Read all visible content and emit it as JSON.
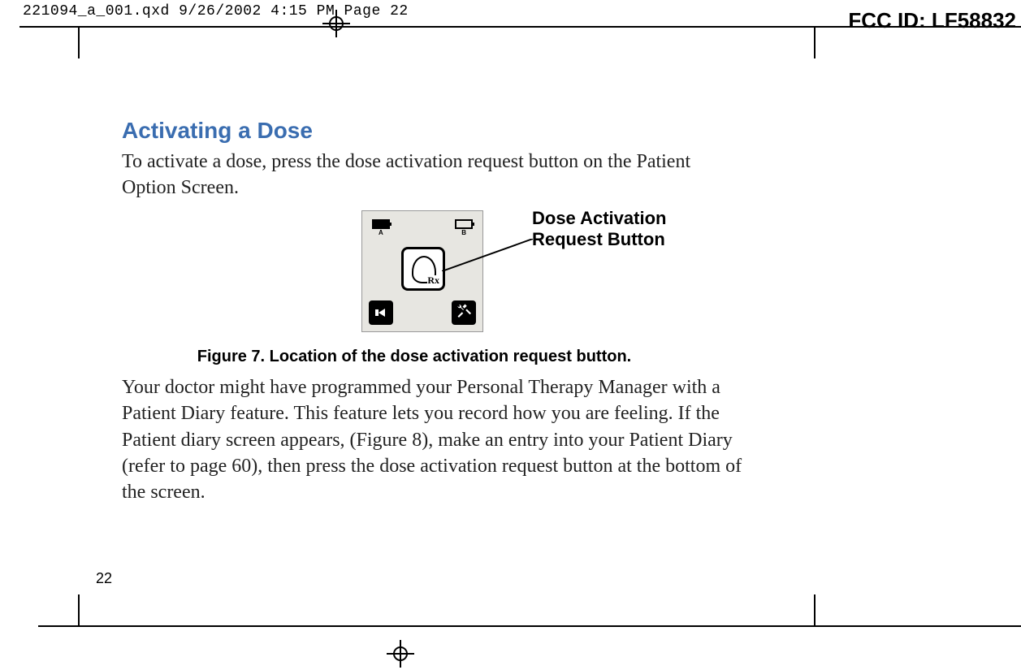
{
  "meta": {
    "slug": "221094_a_001.qxd  9/26/2002  4:15 PM  Page 22",
    "fcc": "FCC ID: LF58832",
    "page_number": "22"
  },
  "heading": "Activating a Dose",
  "intro": "To activate a dose, press the dose activation request button on the Patient Option Screen.",
  "callout": "Dose Activation Request Button",
  "figure_caption": "Figure 7. Location of the dose activation request button.",
  "body2": "Your doctor might have programmed your Personal Therapy Manager with a Patient Diary feature. This feature lets you record how you are feeling. If the Patient diary screen appears, (Figure 8), make an entry into your Patient Diary (refer to page 60), then press the dose activation request button at the bottom of the screen.",
  "device": {
    "battA_label": "A",
    "battB_label": "B",
    "rx": "Rx"
  }
}
